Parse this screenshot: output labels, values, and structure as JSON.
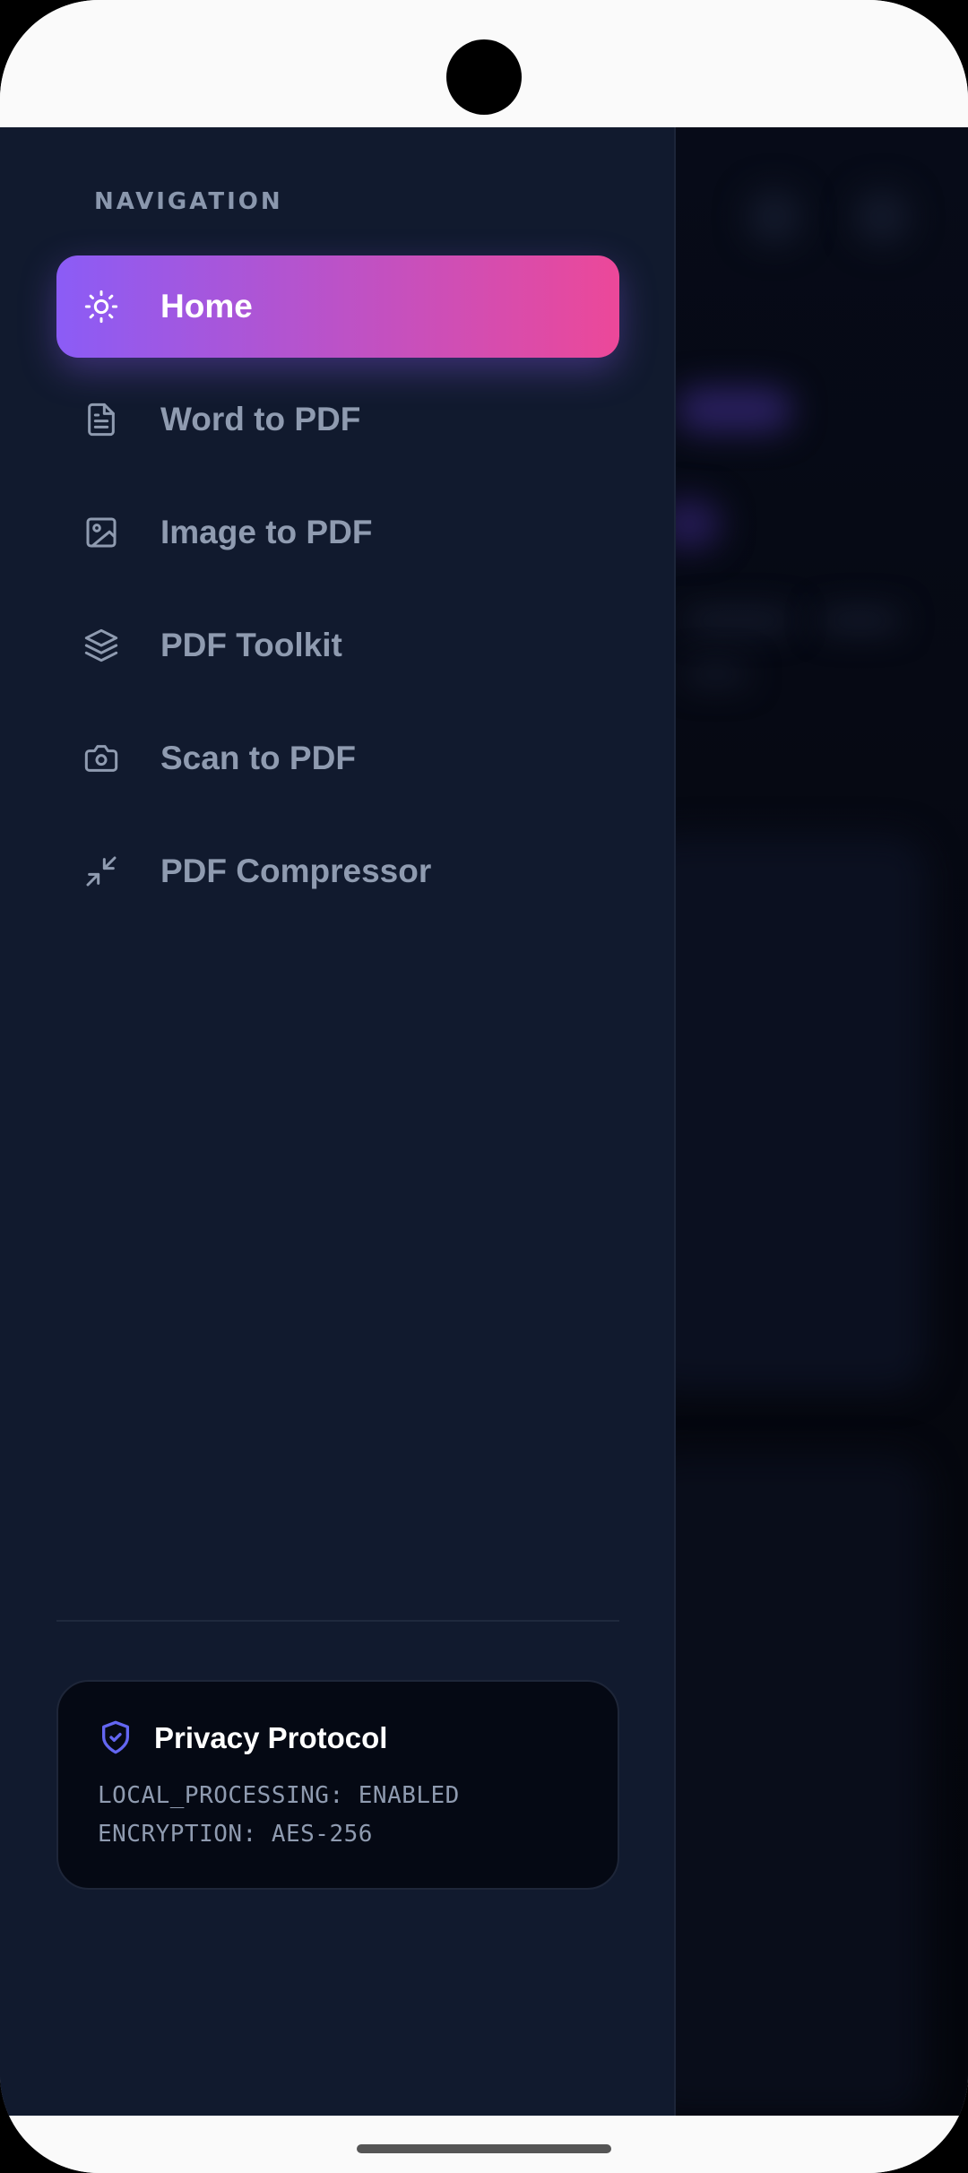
{
  "nav": {
    "heading": "NAVIGATION",
    "items": [
      {
        "label": "Home",
        "icon": "sun-icon",
        "active": true
      },
      {
        "label": "Word to PDF",
        "icon": "file-text-icon",
        "active": false
      },
      {
        "label": "Image to PDF",
        "icon": "image-icon",
        "active": false
      },
      {
        "label": "PDF Toolkit",
        "icon": "layers-icon",
        "active": false
      },
      {
        "label": "Scan to PDF",
        "icon": "camera-icon",
        "active": false
      },
      {
        "label": "PDF Compressor",
        "icon": "minimize-icon",
        "active": false
      }
    ]
  },
  "privacy": {
    "title": "Privacy Protocol",
    "icon": "shield-check-icon",
    "line1": "LOCAL_PROCESSING: ENABLED",
    "line2": "ENCRYPTION: AES-256"
  },
  "colors": {
    "drawer_bg": "#111a2e",
    "active_gradient_start": "#8b5cf6",
    "active_gradient_end": "#ec4899",
    "muted_text": "#8f9bb0",
    "shield_accent": "#6366f1"
  }
}
